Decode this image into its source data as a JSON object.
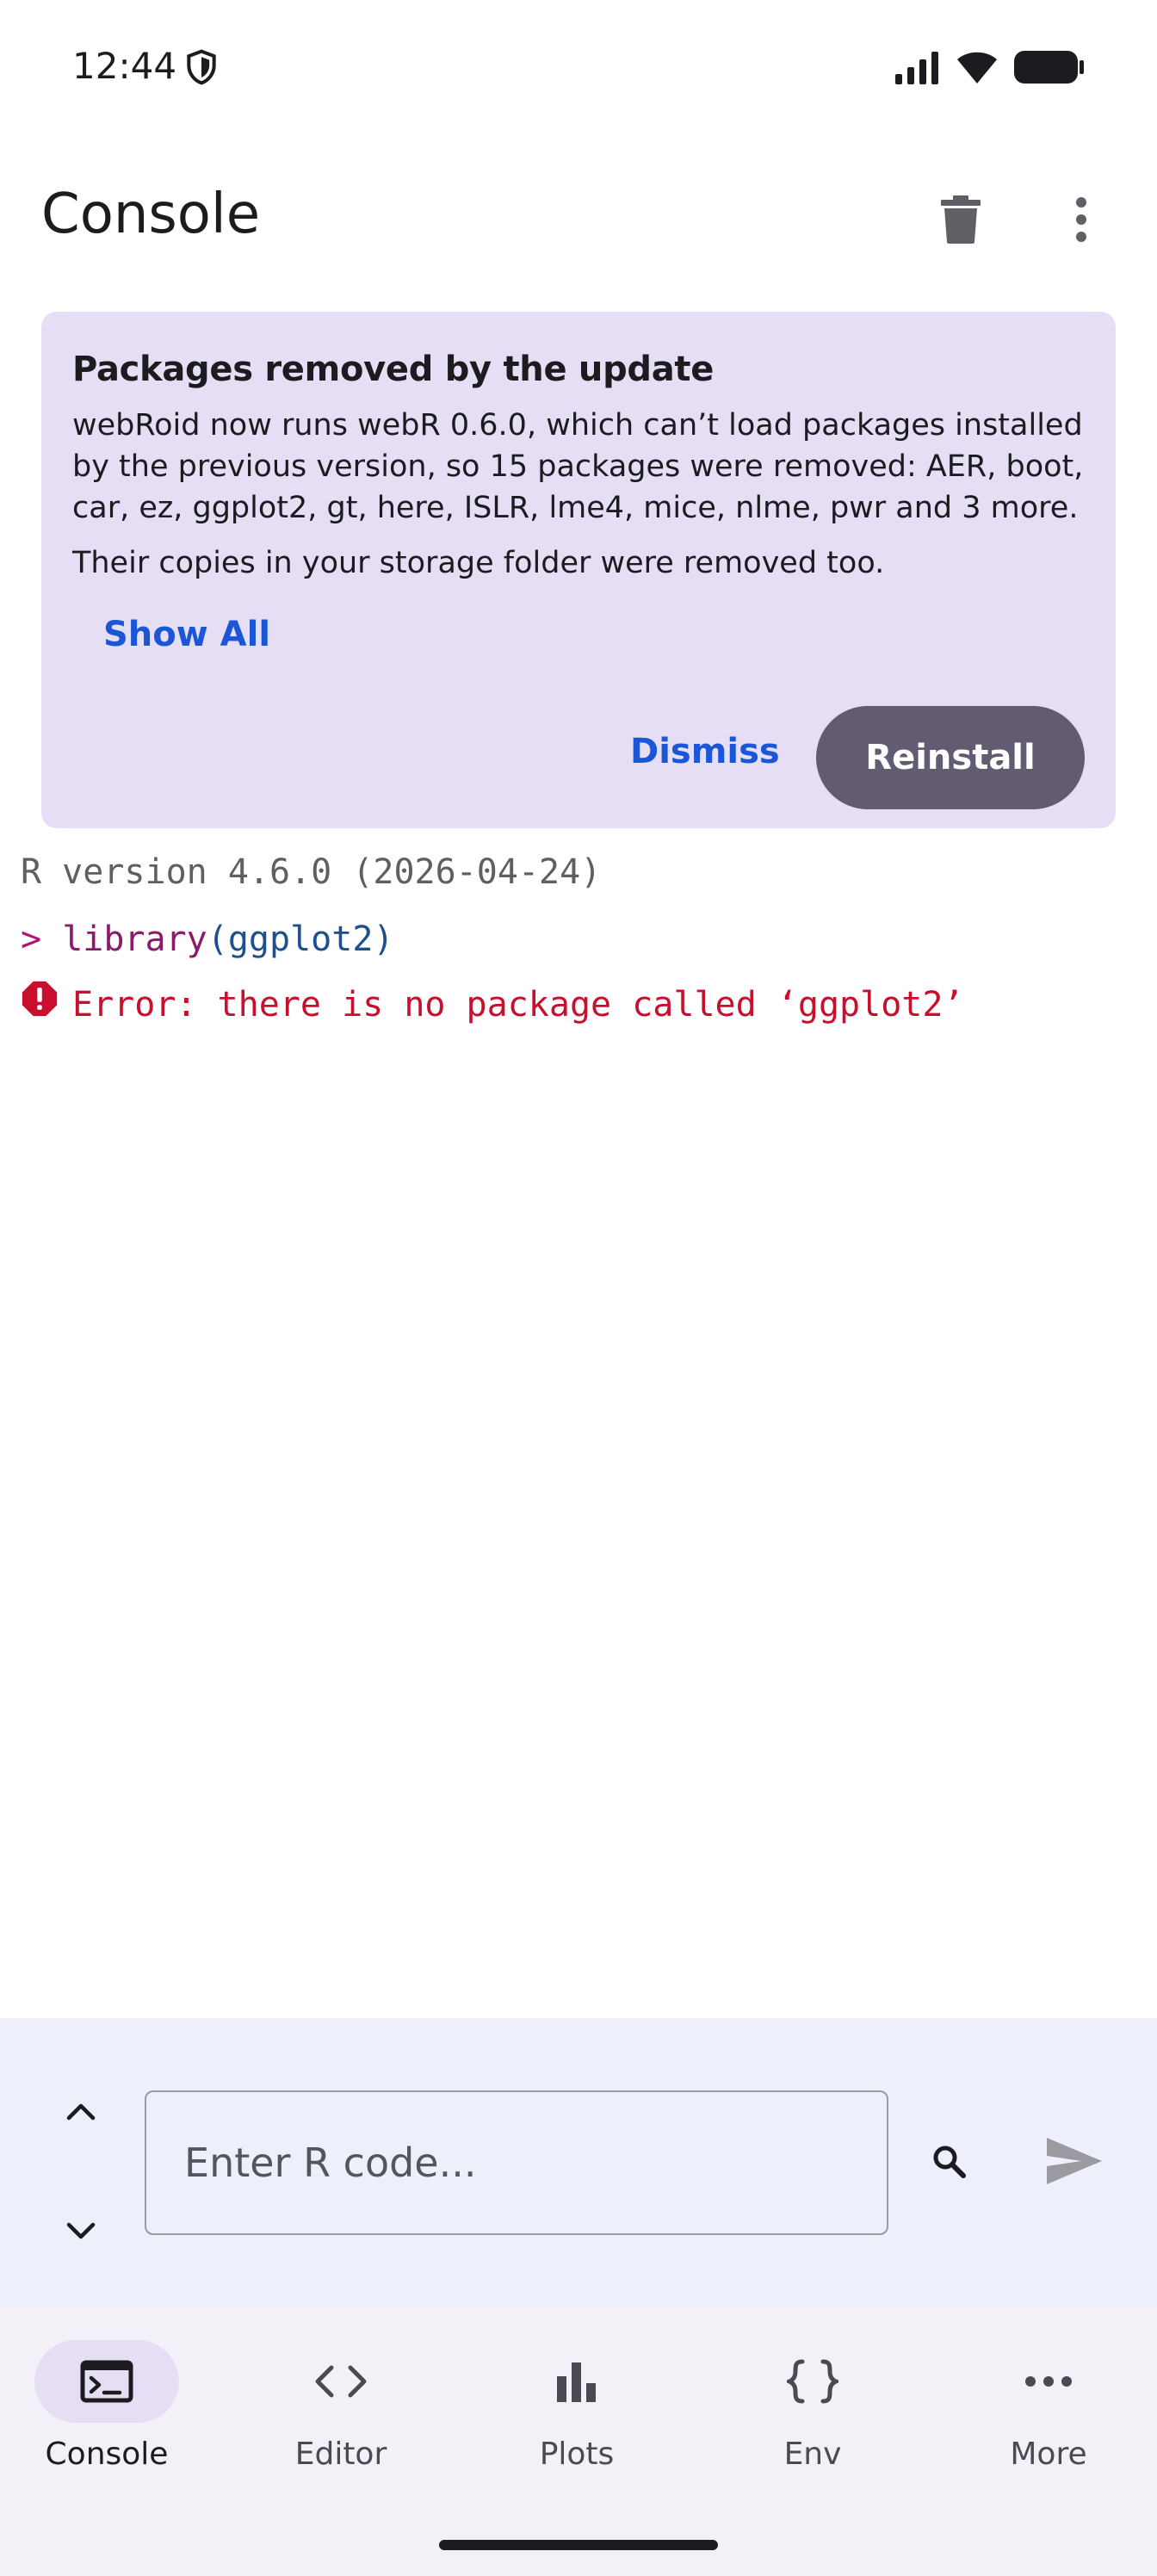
{
  "status_bar": {
    "time": "12:44"
  },
  "app_bar": {
    "title": "Console"
  },
  "banner": {
    "title": "Packages removed by the update",
    "body": "webRoid now runs webR 0.6.0, which can’t load packages installed by the previous version, so 15 packages were removed: AER, boot, car, ez, ggplot2, gt, here, ISLR, lme4, mice, nlme, pwr and 3 more.",
    "body2": "Their copies in your storage folder were removed too.",
    "show_all": "Show All",
    "dismiss": "Dismiss",
    "reinstall": "Reinstall"
  },
  "console": {
    "version_line": "R version 4.6.0 (2026-04-24)",
    "prompt": ">",
    "cmd_fn": "library",
    "cmd_args": "(ggplot2)",
    "error_line": "Error: there is no package called ‘ggplot2’"
  },
  "input": {
    "placeholder": "Enter R code..."
  },
  "nav": {
    "items": [
      {
        "label": "Console",
        "icon": "terminal-icon"
      },
      {
        "label": "Editor",
        "icon": "code-icon"
      },
      {
        "label": "Plots",
        "icon": "bar-chart-icon"
      },
      {
        "label": "Env",
        "icon": "braces-icon"
      },
      {
        "label": "More",
        "icon": "more-horiz-icon"
      }
    ]
  },
  "colors": {
    "banner_bg": "#e6def4",
    "accent_link": "#1a56d6",
    "button_bg": "#625b71",
    "error": "#c8102e",
    "input_area_bg": "#edf0fa",
    "nav_bg": "#f3f0f8"
  }
}
